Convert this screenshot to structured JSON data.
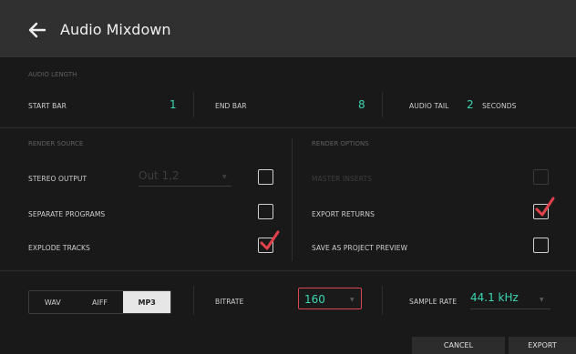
{
  "header": {
    "title": "Audio Mixdown",
    "back_icon": "arrow-left-icon"
  },
  "audio_length": {
    "section_label": "AUDIO LENGTH",
    "start_bar_label": "START BAR",
    "start_bar_value": "1",
    "end_bar_label": "END BAR",
    "end_bar_value": "8",
    "audio_tail_label": "AUDIO TAIL",
    "audio_tail_value": "2",
    "audio_tail_unit": "SECONDS"
  },
  "render_source": {
    "section_label": "RENDER SOURCE",
    "stereo_output_label": "STEREO OUTPUT",
    "stereo_output_value": "Out 1,2",
    "stereo_output_checked": false,
    "separate_programs_label": "SEPARATE PROGRAMS",
    "separate_programs_checked": false,
    "explode_tracks_label": "EXPLODE TRACKS",
    "explode_tracks_checked": true
  },
  "render_options": {
    "section_label": "RENDER OPTIONS",
    "master_inserts_label": "MASTER INSERTS",
    "master_inserts_checked": false,
    "export_returns_label": "EXPORT RETURNS",
    "export_returns_checked": true,
    "save_preview_label": "SAVE AS PROJECT PREVIEW",
    "save_preview_checked": false
  },
  "format": {
    "options": [
      "WAV",
      "AIFF",
      "MP3"
    ],
    "selected": "MP3",
    "bitrate_label": "BITRATE",
    "bitrate_value": "160",
    "sample_rate_label": "SAMPLE RATE",
    "sample_rate_value": "44.1 kHz"
  },
  "footer": {
    "cancel_label": "CANCEL",
    "export_label": "EXPORT"
  },
  "colors": {
    "accent": "#3cd6b3",
    "check": "#e0414b",
    "header": "#303030",
    "background": "#191919"
  }
}
